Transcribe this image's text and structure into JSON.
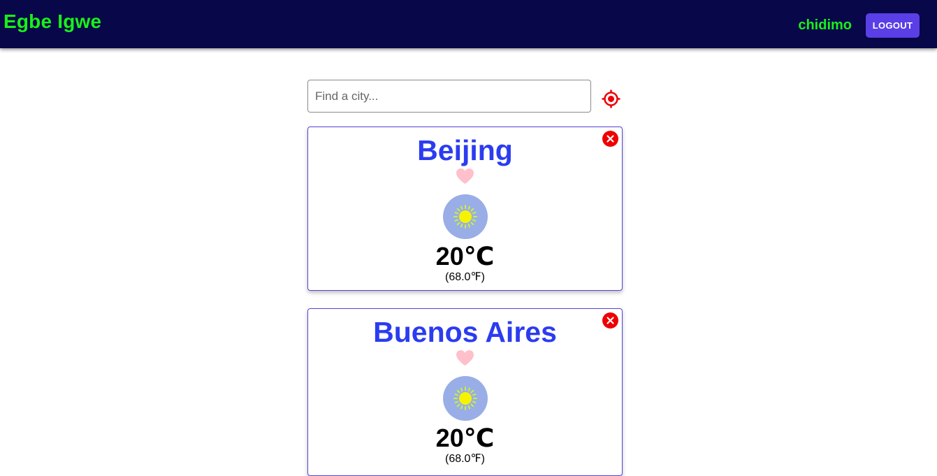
{
  "navbar": {
    "brand": "Egbe Igwe",
    "username": "chidimo",
    "logout_label": "LOGOUT"
  },
  "search": {
    "placeholder": "Find a city...",
    "value": ""
  },
  "icons": {
    "locate": "crosshair-locate-icon",
    "remove": "close-circle-icon",
    "favorite": "heart-icon",
    "weather": "sun-icon"
  },
  "colors": {
    "navbar_bg": "#07074a",
    "brand": "#17f117",
    "accent_button": "#5a3ee6",
    "city_name": "#2b3cf0",
    "remove_icon": "#ee0000",
    "heart": "#ffc0cb",
    "weather_badge": "#99aee6"
  },
  "cities": [
    {
      "name": "Beijing",
      "temp_c": "20℃",
      "temp_f": "(68.0℉)"
    },
    {
      "name": "Buenos Aires",
      "temp_c": "20℃",
      "temp_f": "(68.0℉)"
    }
  ]
}
